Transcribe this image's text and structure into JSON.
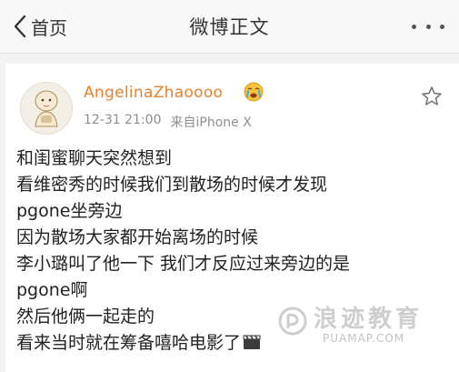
{
  "nav": {
    "back_label": "首页",
    "title": "微博正文"
  },
  "post": {
    "username": "AngelinaZhaoooo",
    "time": "12-31 21:00",
    "source": "来自iPhone X",
    "lines": [
      "和闺蜜聊天突然想到",
      "看维密秀的时候我们到散场的时候才发现",
      "pgone坐旁边",
      "因为散场大家都开始离场的时候",
      "李小璐叫了他一下 我们才反应过来旁边的是",
      "pgone啊",
      "然后他俩一起走的",
      "看来当时就在筹备嘻哈电影了"
    ]
  },
  "watermark": {
    "text": "浪迹教育",
    "url": "PUAMAP.COM"
  },
  "icons": {
    "back": "chevron-left-icon",
    "more": "more-dots-icon",
    "star": "star-outline-icon",
    "emoji": "crying-face-icon",
    "clapper": "clapperboard-icon"
  },
  "colors": {
    "username": "#e8812d",
    "meta": "#8e8e8e",
    "text": "#222222",
    "background": "#f3f3f3"
  }
}
